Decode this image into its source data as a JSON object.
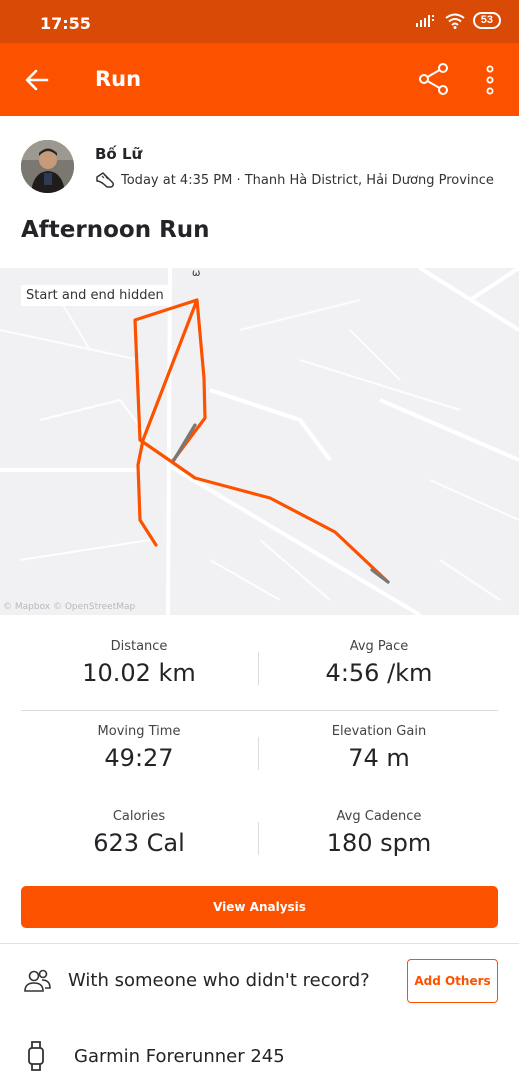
{
  "status_bar": {
    "time": "17:55",
    "battery": "53"
  },
  "app_bar": {
    "title": "Run"
  },
  "athlete": {
    "name": "Bố Lữ",
    "datetime_location": "Today at 4:35 PM · Thanh Hà District, Hải Dương Province"
  },
  "activity": {
    "title": "Afternoon Run"
  },
  "map": {
    "overlay_label": "Start and end hidden",
    "attribution": "© Mapbox © OpenStreetMap",
    "route_color": "#fc5200"
  },
  "stats": [
    {
      "label": "Distance",
      "value": "10.02 km"
    },
    {
      "label": "Avg Pace",
      "value": "4:56 /km"
    },
    {
      "label": "Moving Time",
      "value": "49:27"
    },
    {
      "label": "Elevation Gain",
      "value": "74 m"
    },
    {
      "label": "Calories",
      "value": "623 Cal"
    },
    {
      "label": "Avg Cadence",
      "value": "180 spm"
    }
  ],
  "buttons": {
    "view_analysis": "View Analysis",
    "add_others": "Add Others"
  },
  "with_others": {
    "text": "With someone who didn't record?"
  },
  "device": {
    "name": "Garmin Forerunner 245"
  },
  "colors": {
    "brand": "#fc5200",
    "status_bar": "#d84a05"
  }
}
